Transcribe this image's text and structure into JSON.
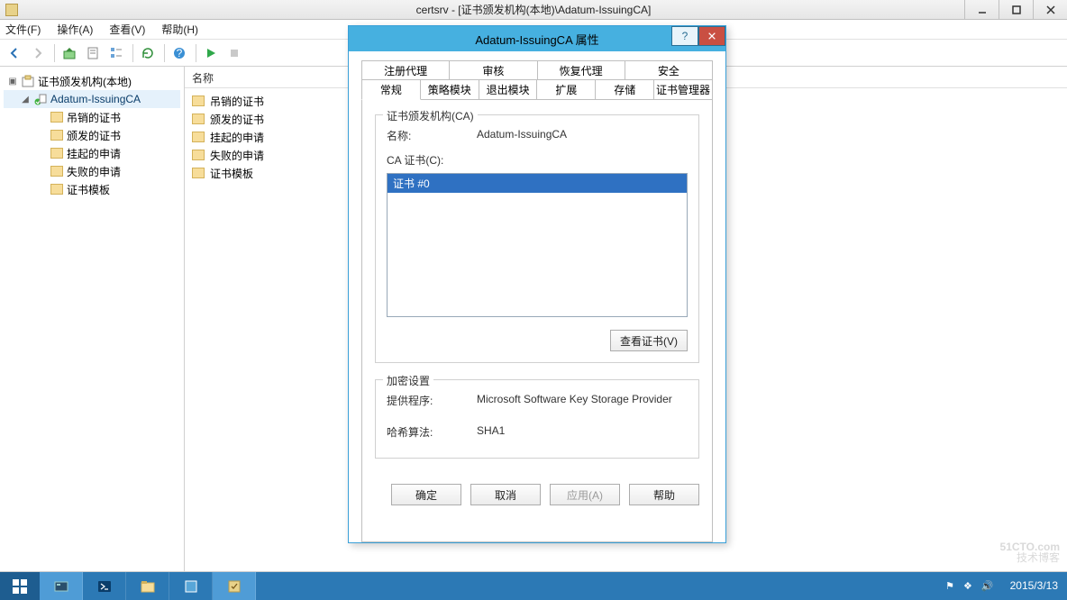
{
  "window": {
    "title": "certsrv - [证书颁发机构(本地)\\Adatum-IssuingCA]"
  },
  "menu": {
    "file": "文件(F)",
    "action": "操作(A)",
    "view": "查看(V)",
    "help": "帮助(H)"
  },
  "tree": {
    "root": "证书颁发机构(本地)",
    "ca": "Adatum-IssuingCA",
    "children": [
      "吊销的证书",
      "颁发的证书",
      "挂起的申请",
      "失败的申请",
      "证书模板"
    ]
  },
  "list": {
    "header": "名称",
    "items": [
      "吊销的证书",
      "颁发的证书",
      "挂起的申请",
      "失败的申请",
      "证书模板"
    ]
  },
  "dialog": {
    "title": "Adatum-IssuingCA 属性",
    "tabs_row1": [
      "注册代理",
      "审核",
      "恢复代理",
      "安全"
    ],
    "tabs_row2": [
      "常规",
      "策略模块",
      "退出模块",
      "扩展",
      "存储",
      "证书管理器"
    ],
    "active_tab": "常规",
    "group_ca_title": "证书颁发机构(CA)",
    "name_label": "名称:",
    "name_value": "Adatum-IssuingCA",
    "ca_cert_label": "CA 证书(C):",
    "ca_cert_selected": "证书 #0",
    "view_cert_btn": "查看证书(V)",
    "group_crypto_title": "加密设置",
    "provider_label": "提供程序:",
    "provider_value": "Microsoft Software Key Storage Provider",
    "hash_label": "哈希算法:",
    "hash_value": "SHA1",
    "ok": "确定",
    "cancel": "取消",
    "apply": "应用(A)",
    "help": "帮助"
  },
  "taskbar": {
    "date": "2015/3/13"
  },
  "watermark": {
    "line1": "51CTO.com",
    "line2": "技术博客"
  }
}
